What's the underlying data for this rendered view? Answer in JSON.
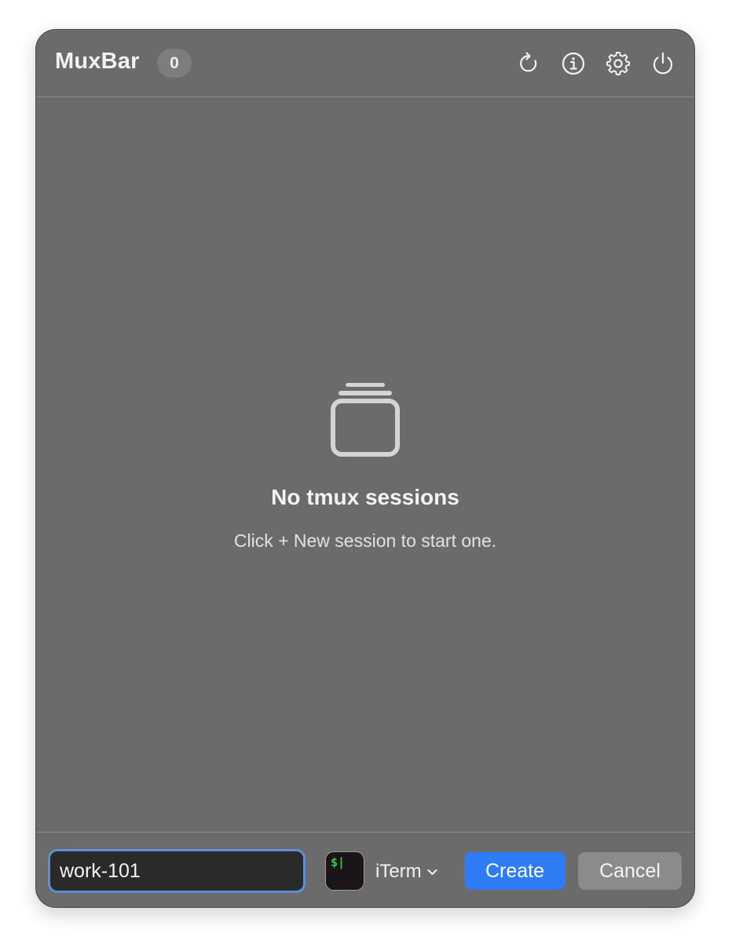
{
  "header": {
    "title": "MuxBar",
    "session_count": "0",
    "icons": [
      "refresh-icon",
      "info-icon",
      "gear-icon",
      "power-icon"
    ]
  },
  "empty_state": {
    "icon": "stacked-windows-icon",
    "title": "No tmux sessions",
    "hint": "Click + New session to start one."
  },
  "footer": {
    "session_name_value": "work-101",
    "terminal_icon_text": "$|",
    "terminal_app": "iTerm",
    "create_label": "Create",
    "cancel_label": "Cancel"
  },
  "colors": {
    "panel_bg": "#6b6b6b",
    "accent": "#2f7cf6",
    "focus_ring": "#5f8ed6",
    "terminal_prompt": "#27d24a"
  }
}
